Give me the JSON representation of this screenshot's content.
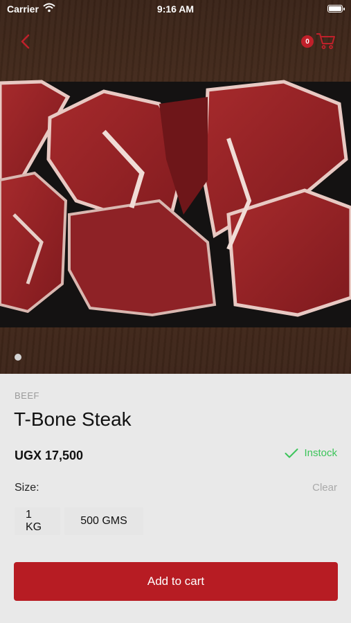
{
  "status_bar": {
    "carrier": "Carrier",
    "time": "9:16 AM"
  },
  "header": {
    "cart_count": "0"
  },
  "hero": {
    "image_alt": "T-Bone steak cuts on a black tray",
    "page_count": 1,
    "active_page": 1
  },
  "product": {
    "category": "BEEF",
    "name": "T-Bone Steak",
    "price": "UGX 17,500",
    "stock_status": "Instock",
    "size_label": "Size:",
    "clear_label": "Clear",
    "sizes": [
      "1 KG",
      "500 GMS"
    ]
  },
  "actions": {
    "add_to_cart": "Add to cart"
  },
  "colors": {
    "accent": "#b71c23",
    "instock": "#3cc45a",
    "badge": "#c0202a"
  },
  "icons": [
    "back-chevron-icon",
    "cart-icon",
    "checkmark-icon",
    "wifi-icon",
    "battery-icon"
  ]
}
